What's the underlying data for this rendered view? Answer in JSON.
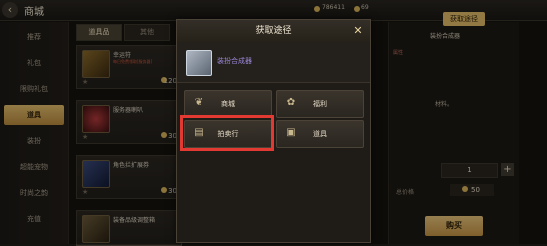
{
  "topbar": {
    "back_icon": "back-arrow-icon",
    "title": "商城",
    "currency_a": "786411",
    "currency_b": "69"
  },
  "sidebar": {
    "items": [
      {
        "label": "推荐"
      },
      {
        "label": "礼包"
      },
      {
        "label": "限购礼包"
      },
      {
        "label": "道具"
      },
      {
        "label": "装扮"
      },
      {
        "label": "超能宠物"
      },
      {
        "label": "时尚之韵"
      },
      {
        "label": "充值"
      }
    ],
    "active_index": 3
  },
  "tabs": [
    {
      "label": "道具品"
    },
    {
      "label": "其他"
    }
  ],
  "shop_items": [
    {
      "name": "幸运符",
      "sub": "每日免费领取[服务器]",
      "price": "120",
      "icon": "lucky-charm-icon"
    },
    {
      "name": "服务器喇叭",
      "sub": "",
      "price": "30",
      "icon": "horn-icon"
    },
    {
      "name": "角色拦扩展券",
      "sub": "",
      "price": "30",
      "icon": "expand-ticket-icon"
    },
    {
      "name": "装备品级调整箱",
      "sub": "",
      "price": "",
      "icon": "box-icon"
    }
  ],
  "right_panel": {
    "preview_label": "获取途径",
    "title": "装扮合成器",
    "tag": "属性",
    "detail_text": "材料。",
    "quantity": "1",
    "total_label": "总价格",
    "total_value": "50",
    "buy_label": "购买"
  },
  "modal": {
    "title": "获取途径",
    "close_icon": "close-x-icon",
    "target_name": "装扮合成器",
    "sources": [
      {
        "label": "商城",
        "icon": "shop-bag-icon"
      },
      {
        "label": "福利",
        "icon": "gift-icon"
      },
      {
        "label": "拍卖行",
        "icon": "auction-icon"
      },
      {
        "label": "道具",
        "icon": "item-box-icon"
      }
    ]
  },
  "colors": {
    "accent_gold": "#e0ba67",
    "highlight_red": "#e23a32",
    "rarity_purple": "#9b86d6"
  }
}
